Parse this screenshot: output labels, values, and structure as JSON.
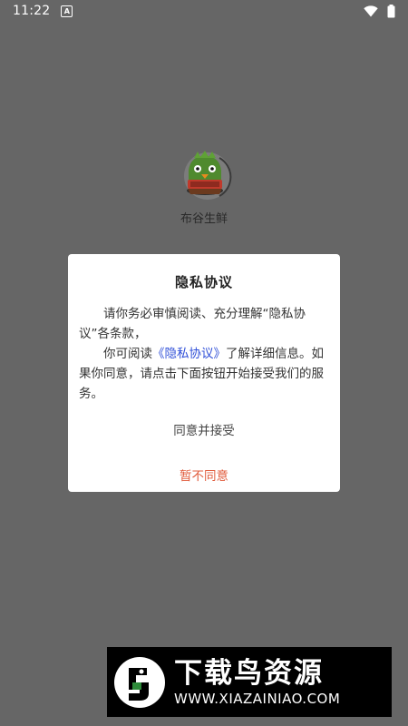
{
  "status_bar": {
    "time": "11:22",
    "notification_icon": "A"
  },
  "app": {
    "name": "布谷生鲜"
  },
  "dialog": {
    "title": "隐私协议",
    "paragraph1": "请你务必审慎阅读、充分理解“隐私协议”各条款，",
    "paragraph2_prefix": "你可阅读",
    "policy_link": "《隐私协议》",
    "paragraph2_suffix": "了解详细信息。如果你同意，请点击下面按钮开始接受我们的服务。",
    "accept_label": "同意并接受",
    "decline_label": "暂不同意"
  },
  "watermark": {
    "title": "下载鸟资源",
    "url": "WWW.XIAZAINIAO.COM"
  },
  "colors": {
    "background": "#666666",
    "link": "#2f4fd8",
    "decline": "#e05b3c"
  },
  "icons": [
    "wifi-icon",
    "battery-icon",
    "notification-a-icon",
    "app-logo-icon",
    "watermark-bird-icon"
  ]
}
